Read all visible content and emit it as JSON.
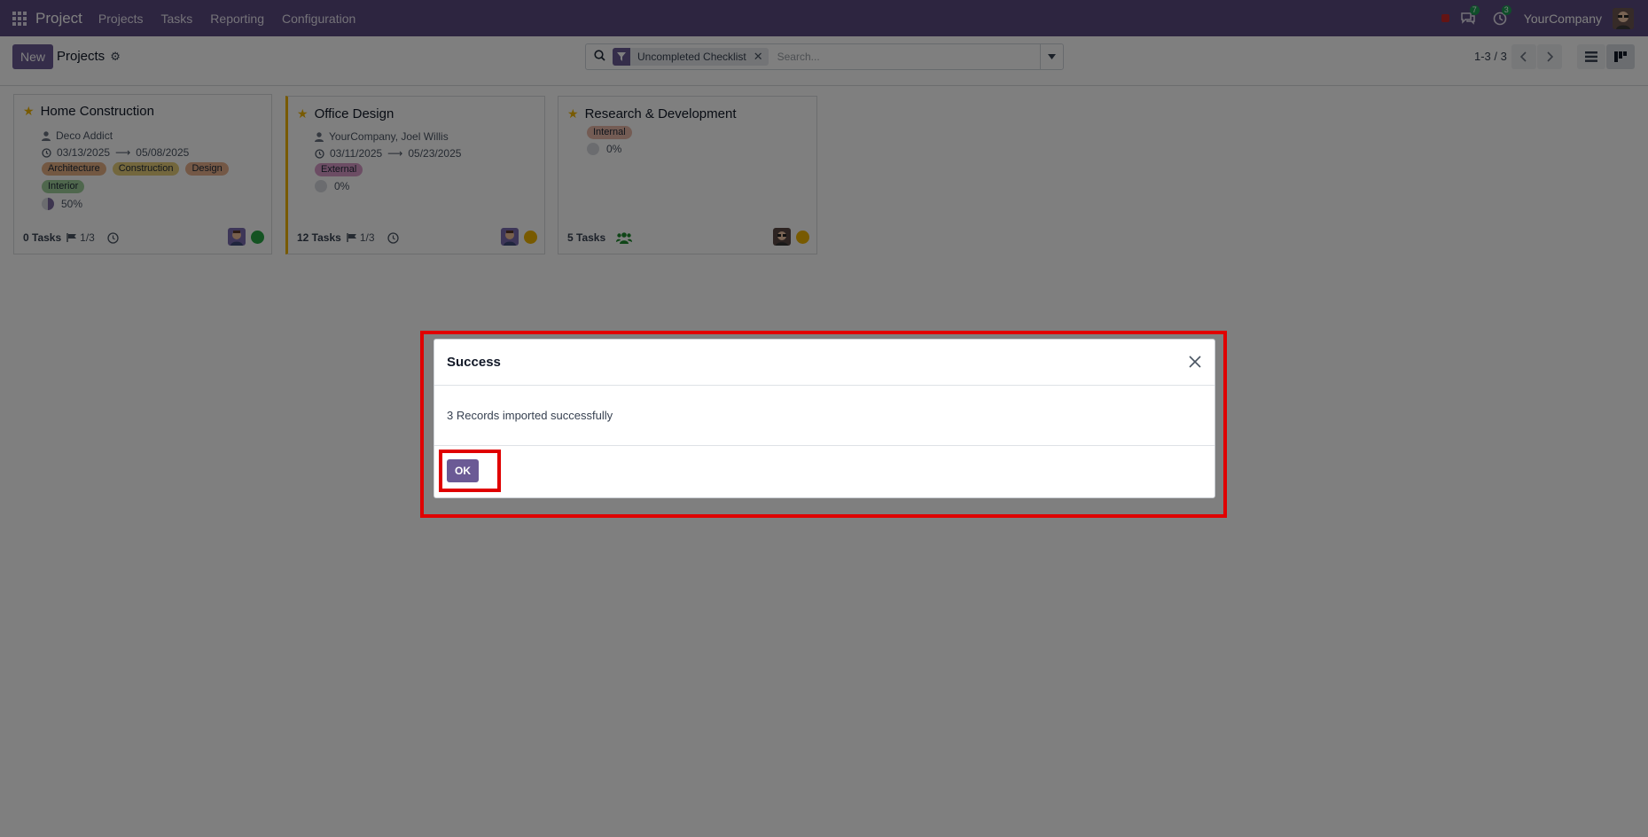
{
  "navbar": {
    "app_name": "Project",
    "menu": [
      "Projects",
      "Tasks",
      "Reporting",
      "Configuration"
    ],
    "discuss_count": "7",
    "activity_count": "3",
    "company": "YourCompany"
  },
  "control_panel": {
    "new_label": "New",
    "breadcrumb": "Projects",
    "search": {
      "facet": "Uncompleted Checklist",
      "placeholder": "Search..."
    },
    "pager": "1-3 / 3"
  },
  "cards": [
    {
      "title": "Home Construction",
      "customer": "Deco Addict",
      "date_start": "03/13/2025",
      "date_end": "05/08/2025",
      "tags": [
        "Architecture",
        "Construction",
        "Design",
        "Interior"
      ],
      "progress": "50%",
      "tasks": "0 Tasks",
      "milestones": "1/3",
      "status_color": "#28a745"
    },
    {
      "title": "Office Design",
      "customer": "YourCompany, Joel Willis",
      "date_start": "03/11/2025",
      "date_end": "05/23/2025",
      "tags": [
        "External"
      ],
      "progress": "0%",
      "tasks": "12 Tasks",
      "milestones": "1/3",
      "status_color": "#f0b400"
    },
    {
      "title": "Research & Development",
      "tags": [
        "Internal"
      ],
      "progress": "0%",
      "tasks": "5 Tasks",
      "status_color": "#f0b400"
    }
  ],
  "dialog": {
    "title": "Success",
    "message": "3 Records imported successfully",
    "ok_label": "OK"
  },
  "colors": {
    "navbar": "#5b4a81",
    "primary": "#6b5a95",
    "highlight": "#e00000",
    "favorite_star": "#f0b400"
  }
}
